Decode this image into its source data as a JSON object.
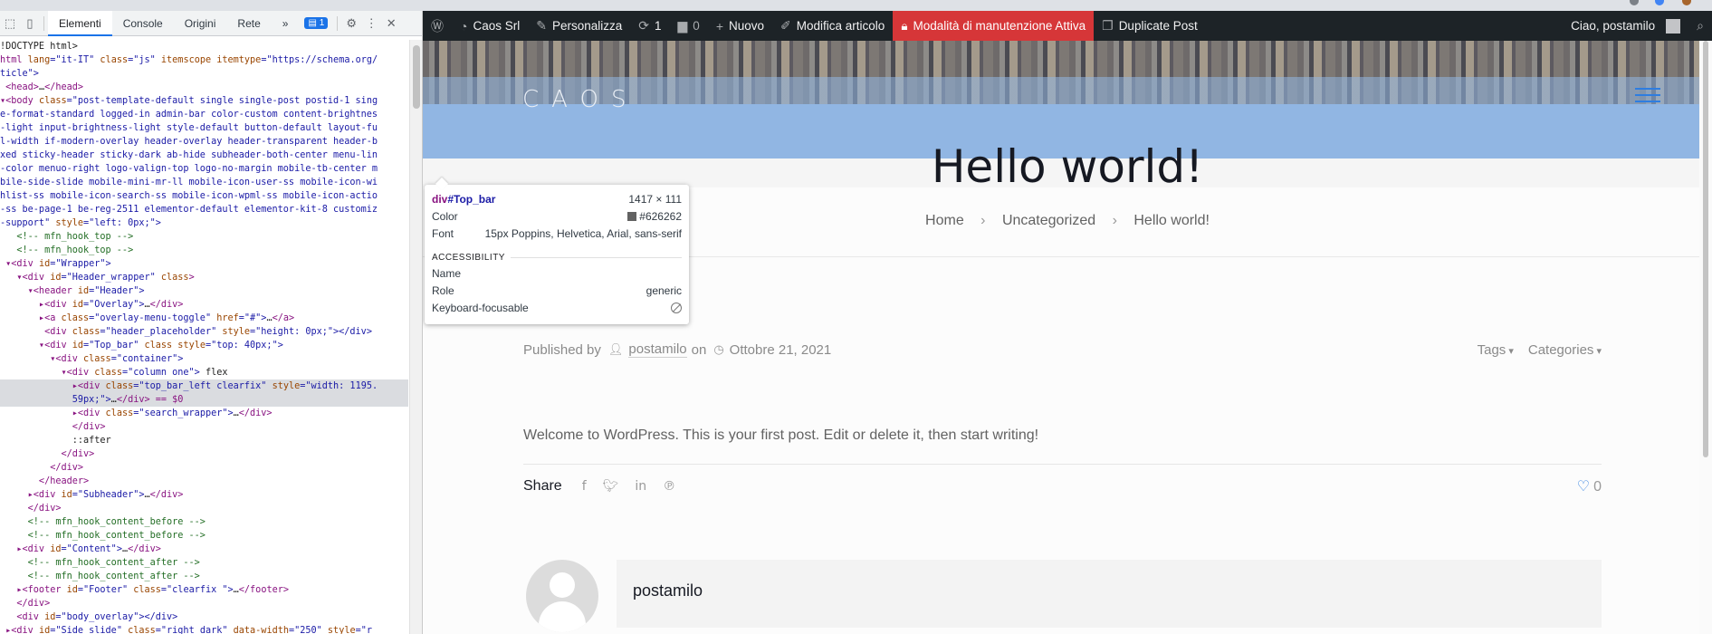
{
  "devtools": {
    "tabs": [
      "Elementi",
      "Console",
      "Origini",
      "Rete"
    ],
    "more": "»",
    "issues_badge": "1",
    "dom_lines": [
      [
        [
          "!DOCTYPE html>",
          "plain"
        ]
      ],
      [
        [
          "html ",
          "tag"
        ],
        [
          "lang",
          "attr"
        ],
        [
          "=\"it-IT\" ",
          "val"
        ],
        [
          "class",
          "attr"
        ],
        [
          "=\"js\" ",
          "val"
        ],
        [
          "itemscope ",
          "attr"
        ],
        [
          "itemtype",
          "attr"
        ],
        [
          "=\"https://schema.org/",
          "val"
        ]
      ],
      [
        [
          "ticle\">",
          "val"
        ]
      ],
      [
        [
          " <head>",
          "tag"
        ],
        [
          "…",
          "plain"
        ],
        [
          "</head>",
          "tag"
        ]
      ],
      [
        [
          "▾<body ",
          "tag"
        ],
        [
          "class",
          "attr"
        ],
        [
          "=\"post-template-default single single-post postid-1 sing",
          "val"
        ]
      ],
      [
        [
          "e-format-standard logged-in admin-bar color-custom content-brightnes",
          "val"
        ]
      ],
      [
        [
          "-light input-brightness-light style-default button-default layout-fu",
          "val"
        ]
      ],
      [
        [
          "l-width if-modern-overlay header-overlay header-transparent header-b",
          "val"
        ]
      ],
      [
        [
          "xed sticky-header sticky-dark ab-hide subheader-both-center menu-lin",
          "val"
        ]
      ],
      [
        [
          "-color menuo-right logo-valign-top logo-no-margin mobile-tb-center m",
          "val"
        ]
      ],
      [
        [
          "bile-side-slide mobile-mini-mr-ll mobile-icon-user-ss mobile-icon-wi",
          "val"
        ]
      ],
      [
        [
          "hlist-ss mobile-icon-search-ss mobile-icon-wpml-ss mobile-icon-actio",
          "val"
        ]
      ],
      [
        [
          "-ss be-page-1 be-reg-2511 elementor-default elementor-kit-8 customiz",
          "val"
        ]
      ],
      [
        [
          "-support\" ",
          "val"
        ],
        [
          "style",
          "attr"
        ],
        [
          "=\"left: 0px;\">",
          "val"
        ]
      ],
      [
        [
          "   <!-- mfn_hook_top -->",
          "com"
        ]
      ],
      [
        [
          "   <!-- mfn_hook_top -->",
          "com"
        ]
      ],
      [
        [
          " ▾<div ",
          "tag"
        ],
        [
          "id",
          "attr"
        ],
        [
          "=\"Wrapper\">",
          "val"
        ]
      ],
      [
        [
          "   ▾<div ",
          "tag"
        ],
        [
          "id",
          "attr"
        ],
        [
          "=\"Header_wrapper\" ",
          "val"
        ],
        [
          "class",
          "attr"
        ],
        [
          ">",
          "tag"
        ]
      ],
      [
        [
          "     ▾<header ",
          "tag"
        ],
        [
          "id",
          "attr"
        ],
        [
          "=\"Header\">",
          "val"
        ]
      ],
      [
        [
          "       ▸<div ",
          "tag"
        ],
        [
          "id",
          "attr"
        ],
        [
          "=\"Overlay\">",
          "val"
        ],
        [
          "…",
          "plain"
        ],
        [
          "</div>",
          "tag"
        ]
      ],
      [
        [
          "       ▸<a ",
          "tag"
        ],
        [
          "class",
          "attr"
        ],
        [
          "=\"overlay-menu-toggle\" ",
          "val"
        ],
        [
          "href",
          "attr"
        ],
        [
          "=\"#\">",
          "val"
        ],
        [
          "…",
          "plain"
        ],
        [
          "</a>",
          "tag"
        ]
      ],
      [
        [
          "        <div ",
          "tag"
        ],
        [
          "class",
          "attr"
        ],
        [
          "=\"header_placeholder\" ",
          "val"
        ],
        [
          "style",
          "attr"
        ],
        [
          "=\"height: 0px;\"></div>",
          "val"
        ]
      ],
      [
        [
          "       ▾<div ",
          "tag"
        ],
        [
          "id",
          "attr"
        ],
        [
          "=\"Top_bar\" ",
          "val"
        ],
        [
          "class ",
          "attr"
        ],
        [
          "style",
          "attr"
        ],
        [
          "=\"top: 40px;\">",
          "val"
        ]
      ],
      [
        [
          "         ▾<div ",
          "tag"
        ],
        [
          "class",
          "attr"
        ],
        [
          "=\"container\">",
          "val"
        ]
      ],
      [
        [
          "           ▾<div ",
          "tag"
        ],
        [
          "class",
          "attr"
        ],
        [
          "=\"column one\"> ",
          "val"
        ],
        [
          "flex",
          "plain"
        ]
      ],
      [
        [
          "             ▸<div ",
          "tag"
        ],
        [
          "class",
          "attr"
        ],
        [
          "=\"top_bar_left clearfix\" ",
          "val"
        ],
        [
          "style",
          "attr"
        ],
        [
          "=\"width: 1195.",
          "val"
        ]
      ],
      [
        [
          "             59px;\">",
          "val"
        ],
        [
          "…",
          "plain"
        ],
        [
          "</div> == $0",
          "tag"
        ]
      ],
      [
        [
          "             ▸<div ",
          "tag"
        ],
        [
          "class",
          "attr"
        ],
        [
          "=\"search_wrapper\">",
          "val"
        ],
        [
          "…",
          "plain"
        ],
        [
          "</div>",
          "tag"
        ]
      ],
      [
        [
          "             </div>",
          "tag"
        ]
      ],
      [
        [
          "             ::after",
          "plain"
        ]
      ],
      [
        [
          "           </div>",
          "tag"
        ]
      ],
      [
        [
          "         </div>",
          "tag"
        ]
      ],
      [
        [
          "       </header>",
          "tag"
        ]
      ],
      [
        [
          "     ▸<div ",
          "tag"
        ],
        [
          "id",
          "attr"
        ],
        [
          "=\"Subheader\">",
          "val"
        ],
        [
          "…",
          "plain"
        ],
        [
          "</div>",
          "tag"
        ]
      ],
      [
        [
          "     </div>",
          "tag"
        ]
      ],
      [
        [
          "     <!-- mfn_hook_content_before -->",
          "com"
        ]
      ],
      [
        [
          "     <!-- mfn_hook_content_before -->",
          "com"
        ]
      ],
      [
        [
          "   ▸<div ",
          "tag"
        ],
        [
          "id",
          "attr"
        ],
        [
          "=\"Content\">",
          "val"
        ],
        [
          "…",
          "plain"
        ],
        [
          "</div>",
          "tag"
        ]
      ],
      [
        [
          "     <!-- mfn_hook_content_after -->",
          "com"
        ]
      ],
      [
        [
          "     <!-- mfn_hook_content_after -->",
          "com"
        ]
      ],
      [
        [
          "   ▸<footer ",
          "tag"
        ],
        [
          "id",
          "attr"
        ],
        [
          "=\"Footer\" ",
          "val"
        ],
        [
          "class",
          "attr"
        ],
        [
          "=\"clearfix \">",
          "val"
        ],
        [
          "…",
          "plain"
        ],
        [
          "</footer>",
          "tag"
        ]
      ],
      [
        [
          "   </div>",
          "tag"
        ]
      ],
      [
        [
          "   <div ",
          "tag"
        ],
        [
          "id",
          "attr"
        ],
        [
          "=\"body_overlay\"></div>",
          "val"
        ]
      ],
      [
        [
          " ▸<div ",
          "tag"
        ],
        [
          "id",
          "attr"
        ],
        [
          "=\"Side_slide\" ",
          "val"
        ],
        [
          "class",
          "attr"
        ],
        [
          "=\"right dark\" ",
          "val"
        ],
        [
          "data-width",
          "attr"
        ],
        [
          "=\"250\" ",
          "val"
        ],
        [
          "style",
          "attr"
        ],
        [
          "=\"r",
          "val"
        ]
      ],
      [
        [
          " ight: -250px;\">",
          "val"
        ],
        [
          "…",
          "plain"
        ],
        [
          "</div>",
          "tag"
        ]
      ]
    ],
    "selected_line": 25
  },
  "adminbar": {
    "site_name": "Caos Srl",
    "customize": "Personalizza",
    "updates_count": "1",
    "comments_count": "0",
    "new": "Nuovo",
    "edit_post": "Modifica articolo",
    "maintenance": "Modalità di manutenzione Attiva",
    "duplicate": "Duplicate Post",
    "greeting": "Ciao, postamilo"
  },
  "site": {
    "logo": "CAOS",
    "title": "Hello world!",
    "breadcrumbs": [
      "Home",
      "Uncategorized",
      "Hello world!"
    ]
  },
  "tooltip": {
    "element": "div",
    "id": "#Top_bar",
    "size": "1417 × 111",
    "color_label": "Color",
    "color_value": "#626262",
    "font_label": "Font",
    "font_value": "15px Poppins, Helvetica, Arial, sans-serif",
    "section": "ACCESSIBILITY",
    "name_label": "Name",
    "role_label": "Role",
    "role_value": "generic",
    "focus_label": "Keyboard-focusable"
  },
  "post": {
    "published_by": "Published by",
    "author": "postamilo",
    "on": "on",
    "date": "Ottobre 21, 2021",
    "tags": "Tags",
    "categories": "Categories",
    "body": "Welcome to WordPress. This is your first post. Edit or delete it, then start writing!",
    "share": "Share",
    "likes": "0",
    "author_box_name": "postamilo"
  }
}
